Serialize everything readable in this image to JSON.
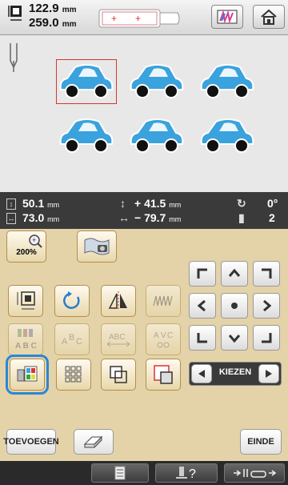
{
  "header": {
    "height_value": "122.9",
    "width_value": "259.0",
    "unit": "mm"
  },
  "info": {
    "height_value": "50.1",
    "width_value": "73.0",
    "offset_y_value": "+ 41.5",
    "offset_x_value": "− 79.7",
    "unit": "mm",
    "rotation": "0°",
    "color_count": "2"
  },
  "panel": {
    "zoom_label": "200%",
    "kiezen_label": "KIEZEN",
    "add_label": "TOEVOEGEN",
    "end_label": "EINDE",
    "icons": {
      "size": "resize-icon",
      "rotate": "rotate-icon",
      "mirror": "mirror-icon",
      "density": "density-icon",
      "multicolor": "multicolor-icon",
      "arc": "arc-text-icon",
      "spacing": "character-spacing-icon",
      "cut": "cut-text-icon",
      "array": "array-icon",
      "border": "border-icon",
      "group": "group-icon",
      "select": "select-icon"
    }
  },
  "colors": {
    "car_body": "#3aa2dc",
    "selection": "#2a87d8",
    "accent_red": "#d33333"
  }
}
